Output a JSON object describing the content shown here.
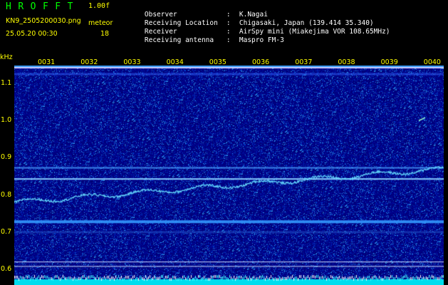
{
  "header": {
    "brand": "HROFFT",
    "version": "1.00f",
    "filename": "KN9_2505200030.png",
    "mode_label": "meteor",
    "datetime": "25.05.20 00:30",
    "count": "18"
  },
  "station": [
    {
      "key": "Observer",
      "value": "K.Nagai"
    },
    {
      "key": "Receiving Location",
      "value": "Chigasaki, Japan (139.414 35.340)"
    },
    {
      "key": "Receiver",
      "value": "AirSpy mini (Miakejima VOR 108.65MHz)"
    },
    {
      "key": "Receiving antenna",
      "value": "Maspro FM-3"
    }
  ],
  "chart_data": {
    "type": "heatmap",
    "yunit": "kHz",
    "ytick_labels": [
      "1.1",
      "1.0",
      "0.9",
      "0.8",
      "0.7",
      "0.6"
    ],
    "y_ticks": [
      1.1,
      1.0,
      0.9,
      0.8,
      0.7,
      0.6
    ],
    "xtick_labels": [
      "0031",
      "0032",
      "0033",
      "0034",
      "0035",
      "0036",
      "0037",
      "0038",
      "0039",
      "0040"
    ],
    "colors": {
      "background": "#00008b",
      "signal": "#00ffff",
      "axis_text": "#ffff00"
    }
  }
}
